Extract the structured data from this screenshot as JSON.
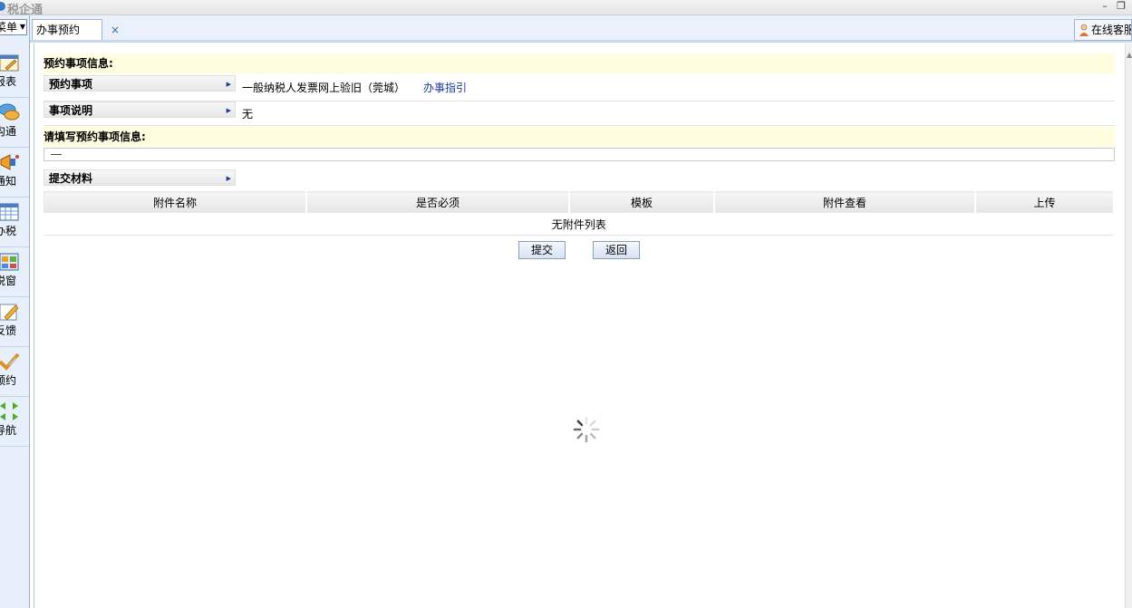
{
  "window": {
    "title": "税企通",
    "minimize_symbol": "–",
    "restore_symbol": "❐"
  },
  "sidebar": {
    "menu_select": "菜单",
    "items": [
      {
        "label": "报表",
        "icon": "report-icon"
      },
      {
        "label": "沟通",
        "icon": "chat-bubbles-icon"
      },
      {
        "label": "通知",
        "icon": "megaphone-icon"
      },
      {
        "label": "办税",
        "icon": "grid-form-icon"
      },
      {
        "label": "税窗",
        "icon": "window-tiles-icon"
      },
      {
        "label": "反馈",
        "icon": "edit-pencil-icon"
      },
      {
        "label": "预约",
        "icon": "check-pen-icon"
      },
      {
        "label": "导航",
        "icon": "arrows-navigation-icon"
      }
    ]
  },
  "tabs": [
    {
      "label": "办事预约",
      "close": "×"
    }
  ],
  "online_service": {
    "label": "在线客服"
  },
  "form": {
    "section1_title": "预约事项信息:",
    "item_label": "预约事项",
    "item_value": "一般纳税人发票网上验旧（莞城）",
    "guide_link": "办事指引",
    "desc_label": "事项说明",
    "desc_value": "无",
    "section2_title": "请填写预约事项信息:",
    "materials_label": "提交材料",
    "table_headers": [
      "附件名称",
      "是否必须",
      "模板",
      "附件查看",
      "上传"
    ],
    "empty_text": "无附件列表",
    "submit_label": "提交",
    "back_label": "返回"
  },
  "colors": {
    "section_bg": "#fffde0",
    "sidebar_bg": "#e6effa",
    "link": "#1a3aa0"
  }
}
